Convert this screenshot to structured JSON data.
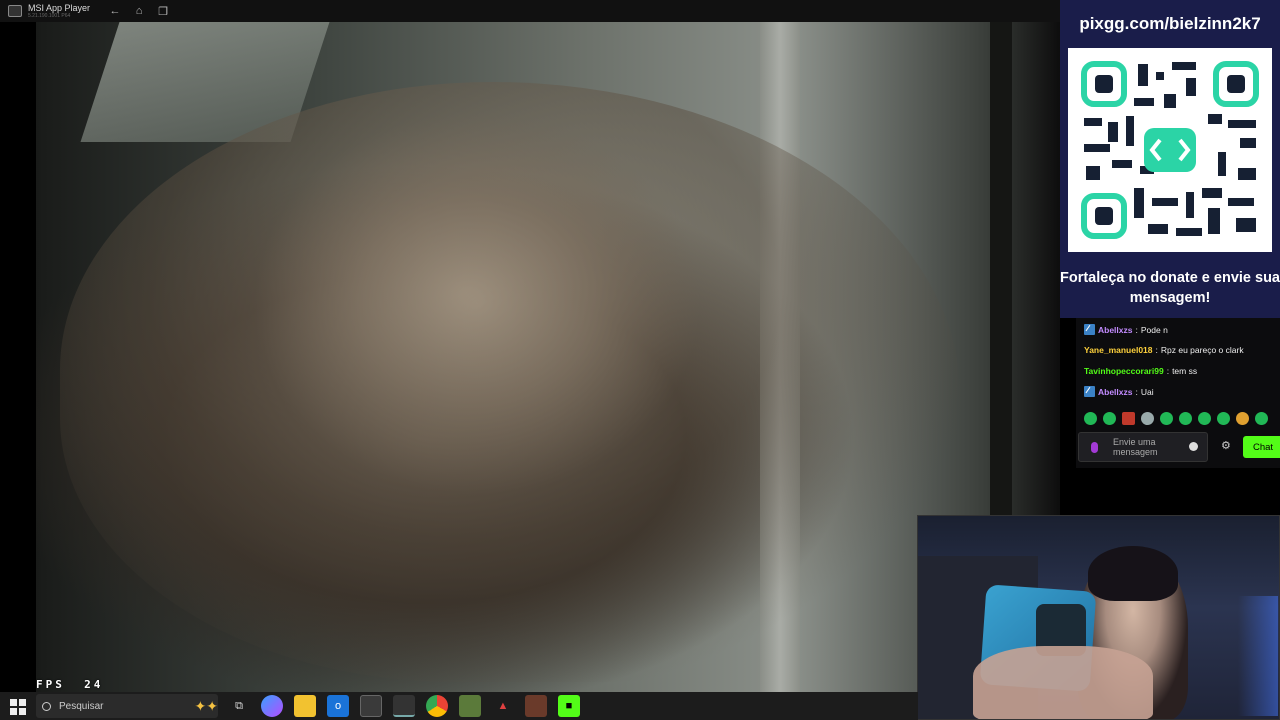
{
  "window": {
    "title": "MSI App Player",
    "subtitle": "5.21.190.1001 P64"
  },
  "video": {
    "fps_label": "FPS",
    "fps_value": "24"
  },
  "donate": {
    "url": "pixgg.com/bielzinn2k7",
    "message": "Fortaleça no donate e envie sua mensagem!"
  },
  "chat": {
    "messages": [
      {
        "user": "Abellxzs",
        "text": "Pode n",
        "user_color": "#c38cff",
        "badge": true
      },
      {
        "user": "Yane_manuel018",
        "text": "Rpz eu pareço o clark",
        "user_color": "#ffd23c",
        "badge": false
      },
      {
        "user": "Tavinhopeccorari99",
        "text": "tem ss",
        "user_color": "#53fc18",
        "badge": false
      },
      {
        "user": "Abellxzs",
        "text": "Uai",
        "user_color": "#c38cff",
        "badge": true
      }
    ],
    "input_placeholder": "Envie uma mensagem",
    "send_label": "Chat"
  },
  "taskbar": {
    "search_placeholder": "Pesquisar",
    "apps": [
      "task-view-icon",
      "copilot-icon",
      "file-explorer-icon",
      "outlook-icon",
      "store-icon",
      "msi-app-player-icon",
      "chrome-icon",
      "minecraft-icon",
      "adobe-icon",
      "game-icon",
      "kick-icon"
    ]
  },
  "colors": {
    "donate_bg": "#1a1d4a",
    "chat_button": "#53fc18",
    "qr_accent": "#2bd4a6"
  }
}
